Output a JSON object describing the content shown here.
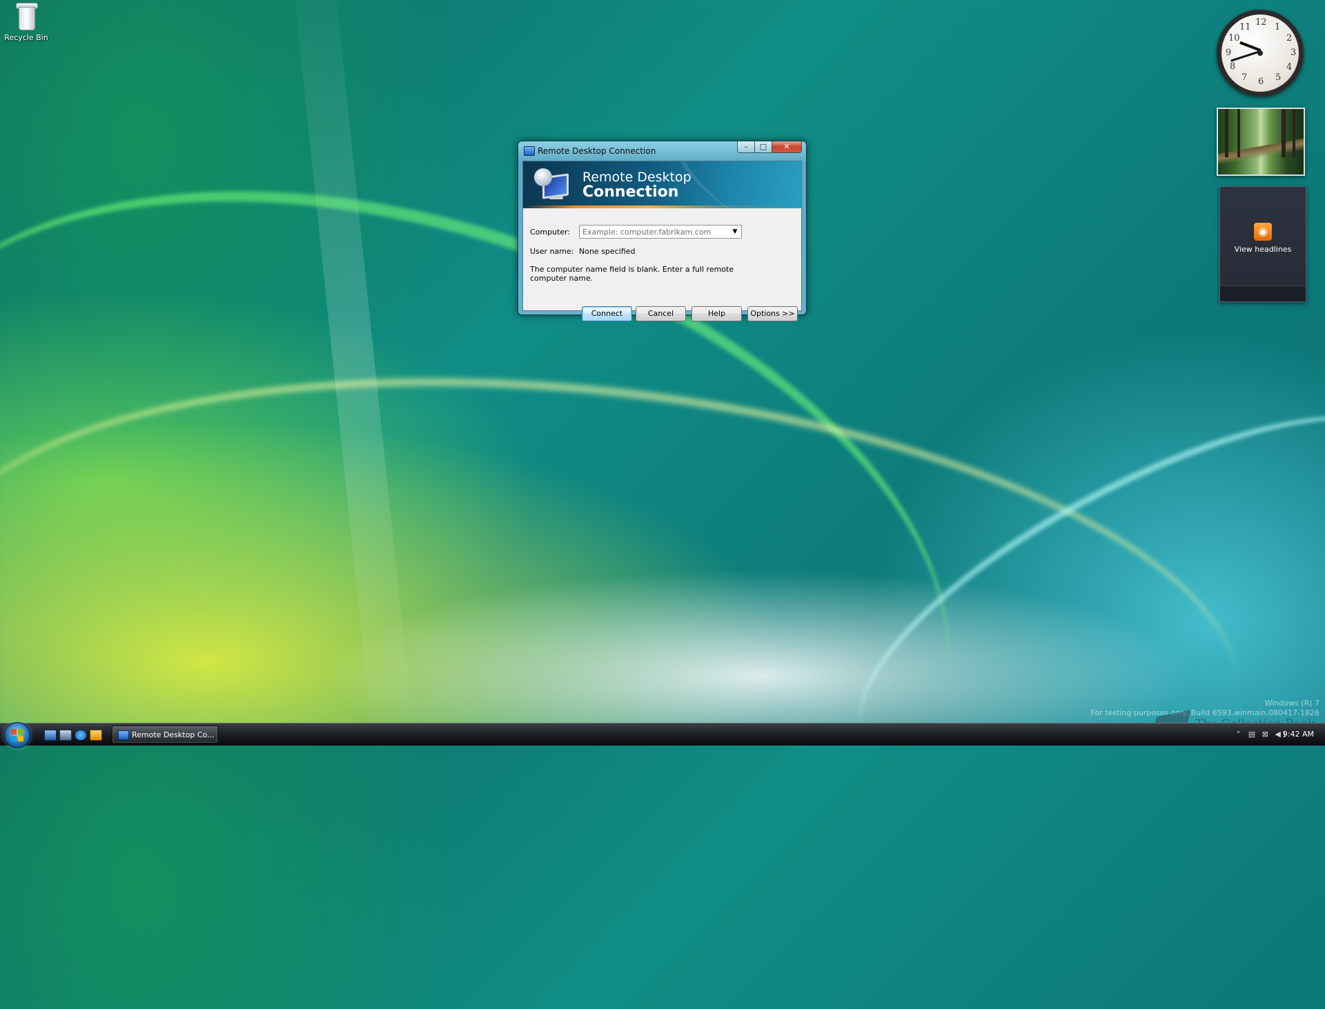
{
  "desktop": {
    "icons": [
      {
        "label": "Recycle Bin",
        "icon": "recycle-bin-icon"
      }
    ]
  },
  "gadgets": {
    "clock": {
      "numbers": [
        "12",
        "1",
        "2",
        "3",
        "4",
        "5",
        "6",
        "7",
        "8",
        "9",
        "10",
        "11"
      ],
      "time": "9:42"
    },
    "feed": {
      "label": "View headlines",
      "icon": "rss-icon"
    }
  },
  "dialog": {
    "title": "Remote Desktop Connection",
    "window_buttons": {
      "minimize": "–",
      "maximize": "□",
      "close": "✕"
    },
    "banner": {
      "line1": "Remote Desktop",
      "line2": "Connection"
    },
    "computer_label": "Computer:",
    "computer_placeholder": "Example: computer.fabrikam.com",
    "computer_value": "",
    "username_label": "User name:",
    "username_value": "None specified",
    "message": "The computer name field is blank.  Enter a full remote computer name.",
    "buttons": {
      "connect": "Connect",
      "cancel": "Cancel",
      "help": "Help",
      "options": "Options >>"
    }
  },
  "taskbar": {
    "task_label": "Remote Desktop Co...",
    "tray_icons": "⌃ ▤ ⊠ ◀)",
    "time": "9:42 AM"
  },
  "watermark": {
    "line1": "Windows (R) 7",
    "line2": "For testing purposes only. Build 6593.winmain.080417-1826",
    "brand": "The Collection Book"
  },
  "colors": {
    "banner": "#115b7f",
    "accent_stripe": "#f08d1e",
    "close_button": "#c74630",
    "default_button": "#3c7fb1"
  }
}
